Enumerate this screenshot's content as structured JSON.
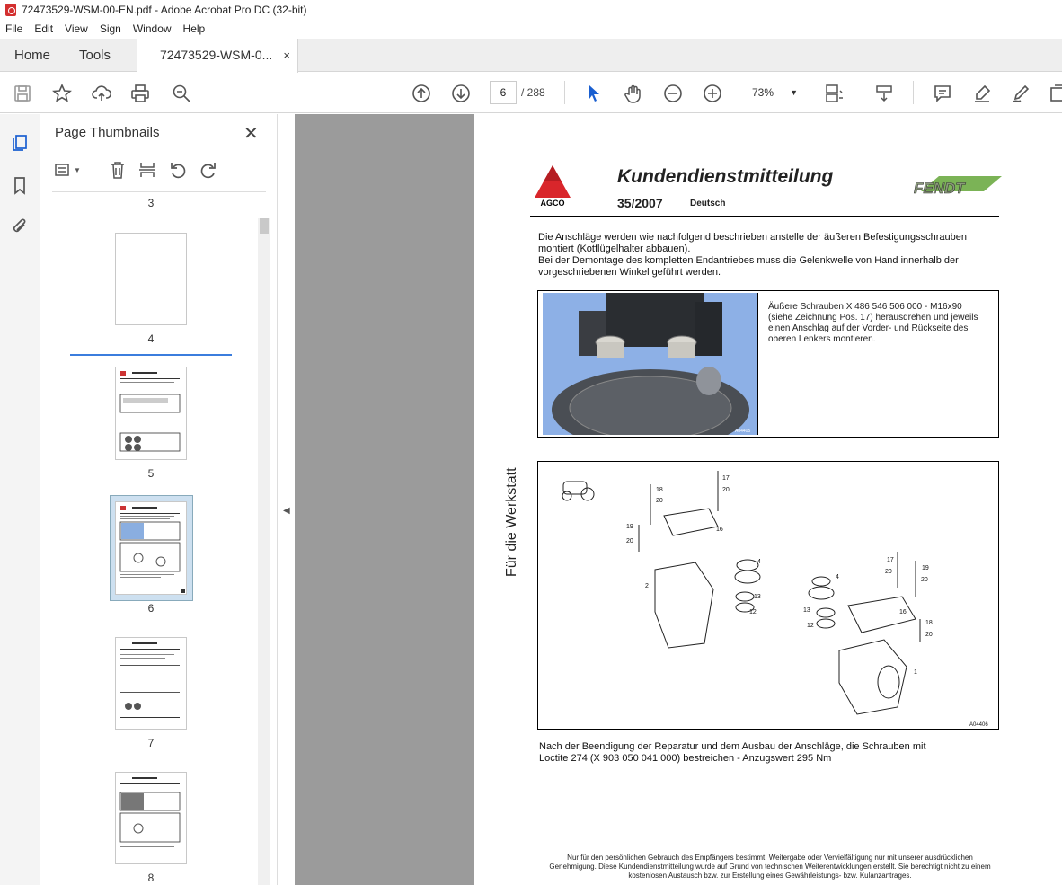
{
  "window": {
    "title": "72473529-WSM-00-EN.pdf - Adobe Acrobat Pro DC (32-bit)"
  },
  "menu": [
    "File",
    "Edit",
    "View",
    "Sign",
    "Window",
    "Help"
  ],
  "tabs": {
    "home": "Home",
    "tools": "Tools",
    "document": "72473529-WSM-0...",
    "close": "×"
  },
  "toolbar": {
    "current_page": "6",
    "total_pages": "/ 288",
    "zoom": "73%"
  },
  "thumbnails_panel": {
    "title": "Page Thumbnails",
    "close": "✕",
    "pages": [
      "3",
      "4",
      "5",
      "6",
      "7",
      "8"
    ],
    "selected_page": "6"
  },
  "document": {
    "title": "Kundendienstmitteilung",
    "number": "35/2007",
    "language": "Deutsch",
    "agco_logo": "AGCO",
    "fendt_logo": "FENDT",
    "intro": [
      "Die Anschläge werden wie nachfolgend beschrieben anstelle der äußeren Befestigungsschrauben",
      "montiert (Kotflügelhalter abbauen).",
      "Bei der Demontage des kompletten Endantriebes muss die Gelenkwelle von Hand innerhalb der",
      "vorgeschriebenen Winkel geführt werden."
    ],
    "box_text": [
      "Äußere Schrauben X 486 546 506 000 - M16x90",
      "(siehe Zeichnung Pos. 17) herausdrehen und jeweils",
      "einen Anschlag auf der Vorder- und Rückseite des",
      "oberen Lenkers montieren."
    ],
    "photo_code": "A04405",
    "side_label": "Für die Werkstatt",
    "drawing_code": "A04406",
    "drawing_labels": [
      "18",
      "20",
      "17",
      "20",
      "19",
      "20",
      "16",
      "4",
      "2",
      "13",
      "12",
      "17",
      "20",
      "19",
      "20",
      "4",
      "13",
      "12",
      "16",
      "18",
      "20",
      "1"
    ],
    "closing": [
      "Nach der Beendigung der Reparatur und dem Ausbau der Anschläge, die Schrauben mit",
      "Loctite 274 (X 903 050 041 000) bestreichen - Anzugswert 295 Nm"
    ],
    "footnote": [
      "Nur für den persönlichen Gebrauch des Empfängers bestimmt. Weitergabe oder Vervielfältigung nur mit unserer ausdrücklichen",
      "Genehmigung. Diese Kundendienstmitteilung wurde auf Grund von technischen Weiterentwicklungen erstellt. Sie berechtigt nicht zu einem",
      "kostenlosen Austausch bzw. zur Erstellung eines Gewährleistungs- bzw. Kulanzantrages."
    ]
  }
}
